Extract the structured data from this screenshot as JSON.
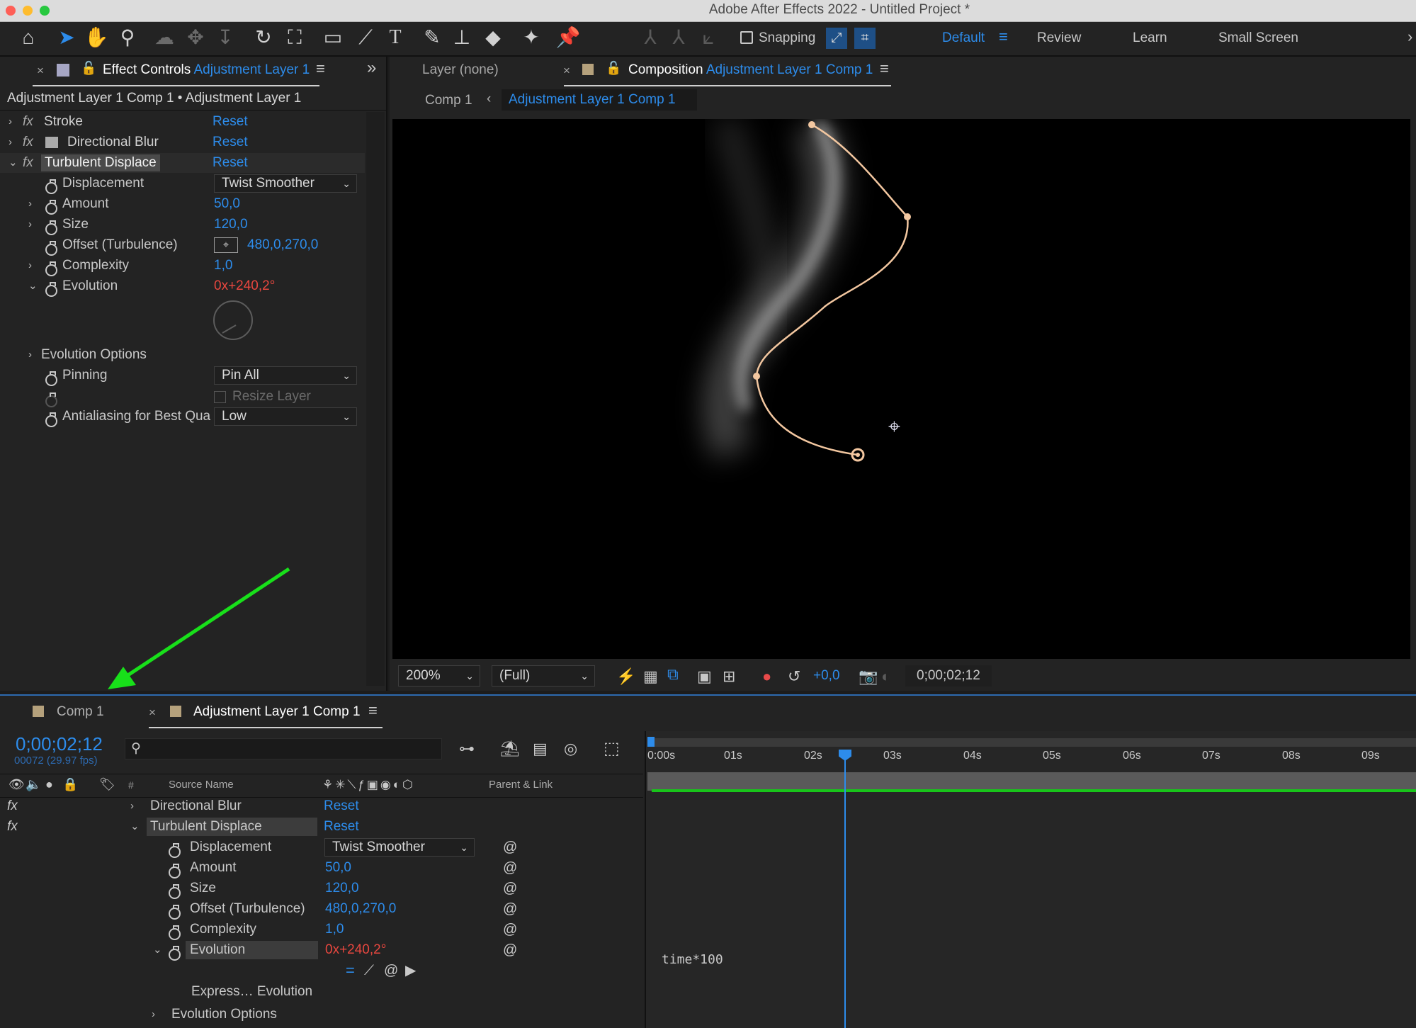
{
  "window": {
    "title": "Adobe After Effects 2022 - Untitled Project *"
  },
  "toolbar": {
    "snapping_label": "Snapping",
    "workspaces": [
      "Default",
      "Review",
      "Learn",
      "Small Screen"
    ]
  },
  "effect_controls": {
    "tab_prefix": "Effect Controls",
    "tab_layer": "Adjustment Layer 1",
    "breadcrumb": "Adjustment Layer 1 Comp 1 • Adjustment Layer 1",
    "effects": [
      {
        "name": "Stroke",
        "reset": "Reset"
      },
      {
        "name": "Directional Blur",
        "reset": "Reset"
      },
      {
        "name": "Turbulent Displace",
        "reset": "Reset"
      }
    ],
    "params": {
      "displacement": {
        "label": "Displacement",
        "value": "Twist Smoother"
      },
      "amount": {
        "label": "Amount",
        "value": "50,0"
      },
      "size": {
        "label": "Size",
        "value": "120,0"
      },
      "offset": {
        "label": "Offset (Turbulence)",
        "value": "480,0,270,0"
      },
      "complexity": {
        "label": "Complexity",
        "value": "1,0"
      },
      "evolution": {
        "label": "Evolution",
        "rev": "0x",
        "deg": "+240,2°"
      },
      "evolution_options": {
        "label": "Evolution Options"
      },
      "pinning": {
        "label": "Pinning",
        "value": "Pin All"
      },
      "resize_layer": {
        "label": "Resize Layer"
      },
      "antialiasing": {
        "label": "Antialiasing for Best Qua",
        "value": "Low"
      }
    }
  },
  "viewer": {
    "layer_tab": "Layer (none)",
    "comp_tab_prefix": "Composition",
    "comp_tab_name": "Adjustment Layer 1 Comp 1",
    "crumb_parent": "Comp 1",
    "crumb_current": "Adjustment Layer 1 Comp 1",
    "zoom": "200%",
    "resolution": "(Full)",
    "exposure": "+0,0",
    "timecode": "0;00;02;12"
  },
  "timeline": {
    "tabs": [
      "Comp 1",
      "Adjustment Layer 1 Comp 1"
    ],
    "timecode": "0;00;02;12",
    "frames": "00072 (29.97 fps)",
    "col_number": "#",
    "col_source": "Source Name",
    "col_parent": "Parent & Link",
    "ruler": [
      "0:00s",
      "01s",
      "02s",
      "03s",
      "04s",
      "05s",
      "06s",
      "07s",
      "08s",
      "09s"
    ],
    "rows": {
      "directional_blur": {
        "name": "Directional Blur",
        "reset": "Reset"
      },
      "turbulent": {
        "name": "Turbulent Displace",
        "reset": "Reset"
      },
      "displacement": {
        "label": "Displacement",
        "value": "Twist Smoother"
      },
      "amount": {
        "label": "Amount",
        "value": "50,0"
      },
      "size": {
        "label": "Size",
        "value": "120,0"
      },
      "offset": {
        "label": "Offset (Turbulence)",
        "value": "480,0,270,0"
      },
      "complexity": {
        "label": "Complexity",
        "value": "1,0"
      },
      "evolution": {
        "label": "Evolution",
        "rev": "0x",
        "deg": "+240,2°"
      },
      "expression_label": "Express… Evolution",
      "expression_code": "time*100",
      "evolution_options": "Evolution Options"
    }
  },
  "colors": {
    "accent": "#2d8ceb",
    "keyframe_red": "#e8473f",
    "arrow_green": "#18e01a",
    "path": "#f3c7a0"
  }
}
